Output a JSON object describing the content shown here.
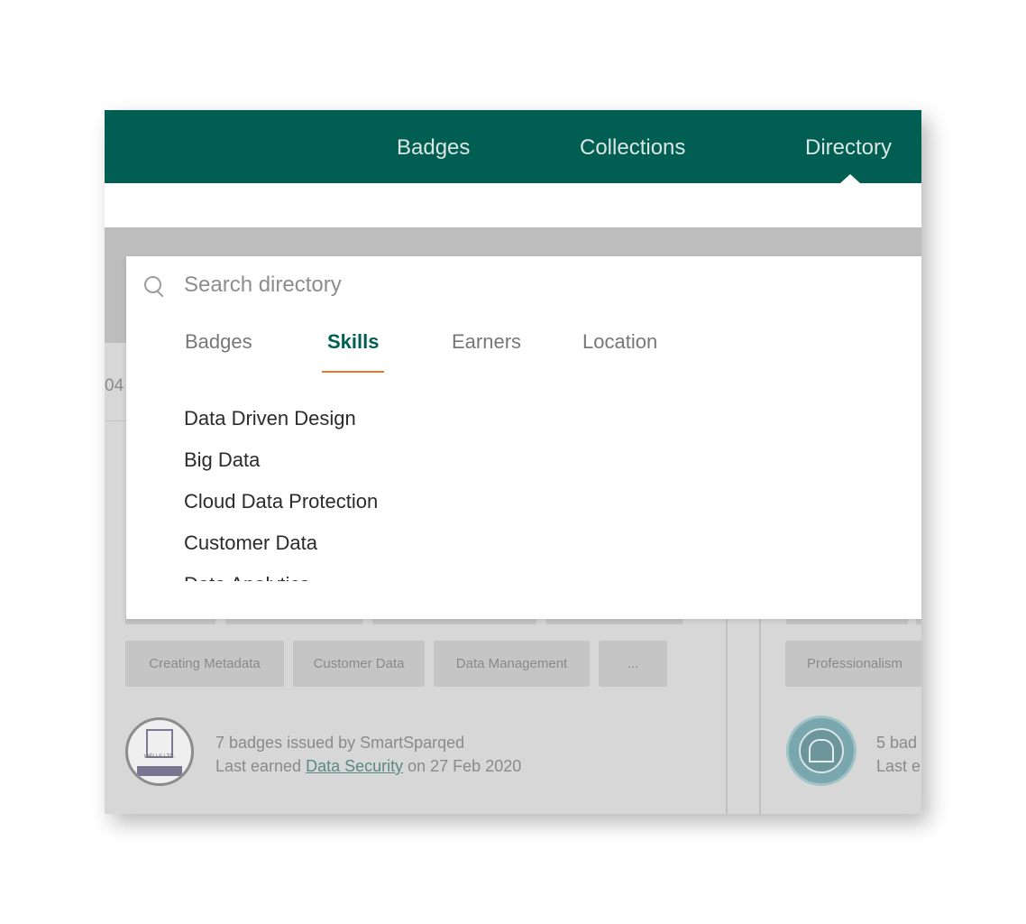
{
  "nav": {
    "items": [
      "Badges",
      "Collections",
      "Directory"
    ],
    "active": "Directory"
  },
  "background": {
    "partial_number": "04",
    "card_left": {
      "tags": [
        "Creating Metadata",
        "Customer Data",
        "Data Management",
        "..."
      ],
      "issuer_text": "7 badges issued by SmartSparqed",
      "last_earned_prefix": "Last earned ",
      "last_earned_link": "Data Security",
      "last_earned_suffix": " on 27 Feb 2020",
      "avatar_org": "WELLS LTD."
    },
    "card_right": {
      "tags": [
        "Professionalism"
      ],
      "issuer_text": "5 bad",
      "last_earned_prefix": "Last e"
    }
  },
  "search": {
    "placeholder": "Search directory",
    "value": ""
  },
  "filters": {
    "tabs": [
      "Badges",
      "Skills",
      "Earners",
      "Location"
    ],
    "active": "Skills"
  },
  "results": [
    "Data Driven Design",
    "Big Data",
    "Cloud Data Protection",
    "Customer Data",
    "Data Analytics"
  ],
  "colors": {
    "brand": "#005e52",
    "accent": "#e8772e",
    "overlay_gray": "#d7d7d7"
  }
}
